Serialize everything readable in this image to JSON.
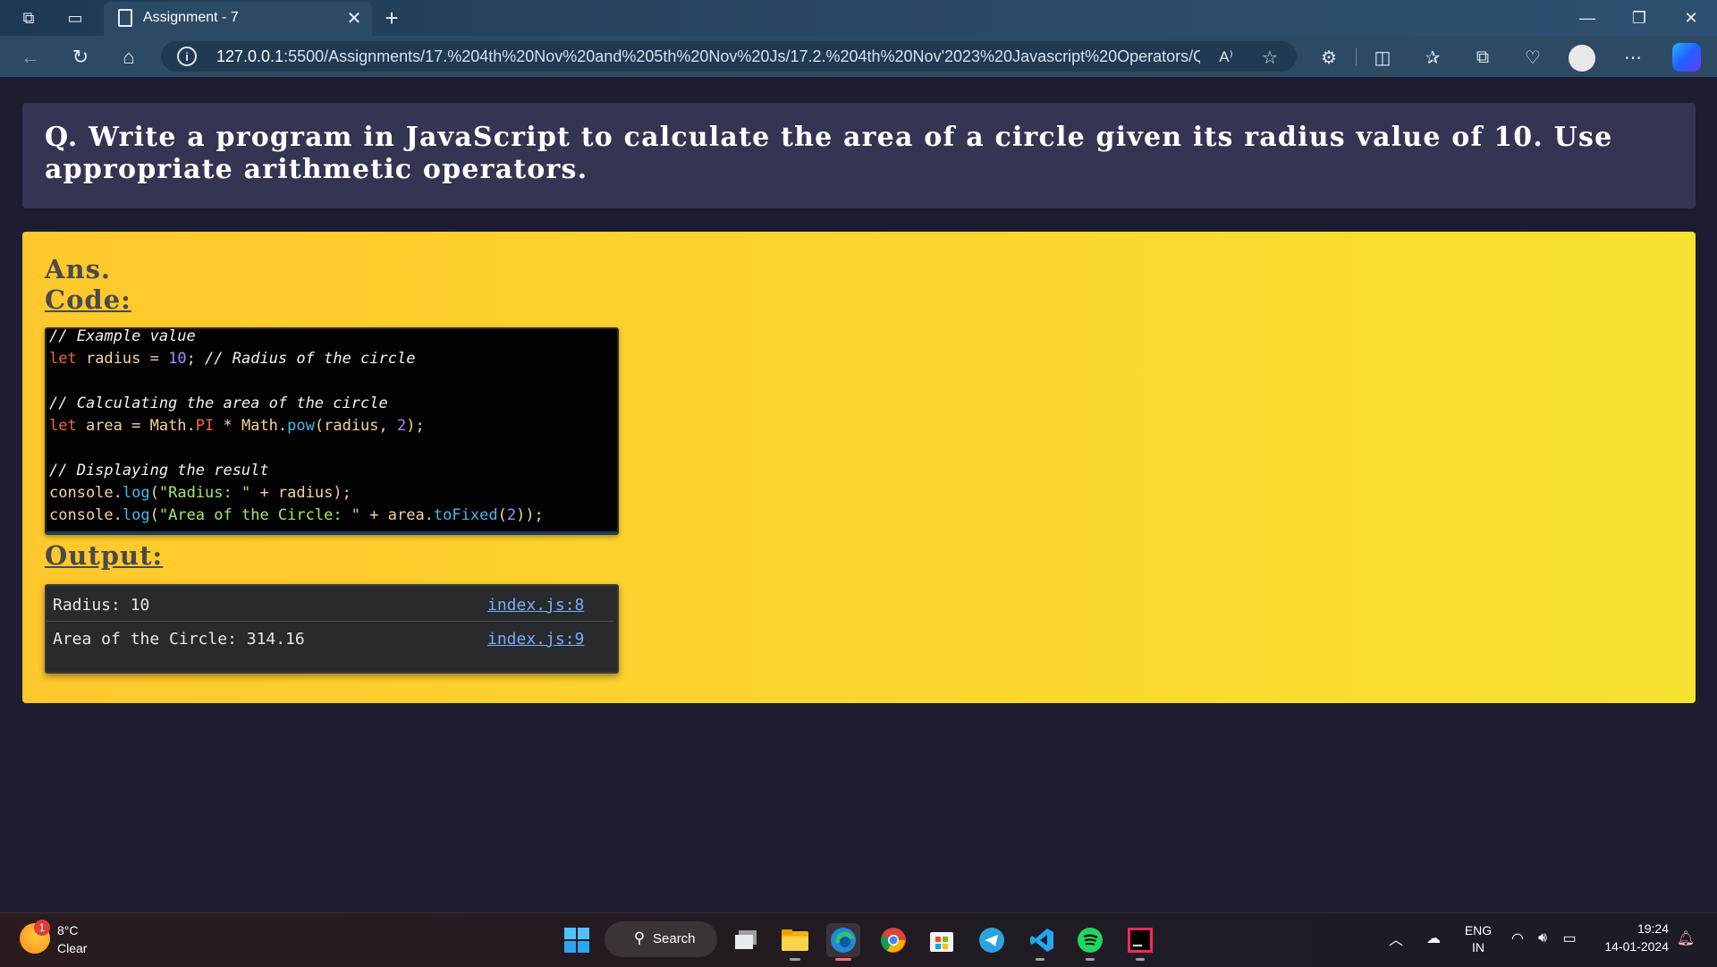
{
  "browser": {
    "tab_title": "Assignment - 7",
    "url_host": "127.0.0.1",
    "url_rest": ":5500/Assignments/17.%204th%20Nov%20and%205th%20Nov%20Js/17.2.%204th%20Nov'2023%20Javascript%20Operators/Questi..."
  },
  "question": "Q. Write a program in JavaScript to calculate the area of a circle given its radius value of 10. Use appropriate arithmetic operators.",
  "answer": {
    "ans_label": "Ans.",
    "code_label": "Code:",
    "output_label": "Output:"
  },
  "code_tokens": {
    "l1_comment": "// Example value",
    "l2_let": "let",
    "l2_radius": " radius = ",
    "l2_num": "10",
    "l2_semi": "; ",
    "l2_comment": "// Radius of the circle",
    "l4_comment": "// Calculating the area of the circle",
    "l5_let": "let",
    "l5_area": " area = Math.",
    "l5_pi": "PI",
    "l5_op": " * Math.",
    "l5_pow": "pow",
    "l5_args": "(radius, ",
    "l5_num": "2",
    "l5_end": ");",
    "l7_comment": "// Displaying the result",
    "l8_console": "console.",
    "l8_log": "log",
    "l8_open": "(",
    "l8_str": "\"Radius: \"",
    "l8_rest": " + radius);",
    "l9_console": "console.",
    "l9_log": "log",
    "l9_open": "(",
    "l9_str": "\"Area of the Circle: \"",
    "l9_mid": " + area.",
    "l9_fixed": "toFixed",
    "l9_open2": "(",
    "l9_num": "2",
    "l9_end": "));"
  },
  "console_output": [
    {
      "text": "Radius: 10",
      "source": "index.js:8"
    },
    {
      "text": "Area of the Circle: 314.16",
      "source": "index.js:9"
    }
  ],
  "taskbar": {
    "weather_temp": "8°C",
    "weather_condition": "Clear",
    "weather_badge": "1",
    "search_label": "Search",
    "lang_1": "ENG",
    "lang_2": "IN",
    "time": "19:24",
    "date": "14-01-2024"
  },
  "icons": {
    "workspaces": "workspaces-icon",
    "tab_actions": "tab-actions-icon",
    "page": "page-icon",
    "close": "close-icon",
    "plus": "plus-icon",
    "back": "back-icon",
    "refresh": "refresh-icon",
    "home": "home-icon",
    "read_aloud": "read-aloud-icon",
    "favorite": "star-icon",
    "extensions": "extensions-icon",
    "split": "split-screen-icon",
    "favorites": "favorites-icon",
    "collections": "collections-icon",
    "health": "browser-essentials-icon",
    "more": "more-icon"
  }
}
